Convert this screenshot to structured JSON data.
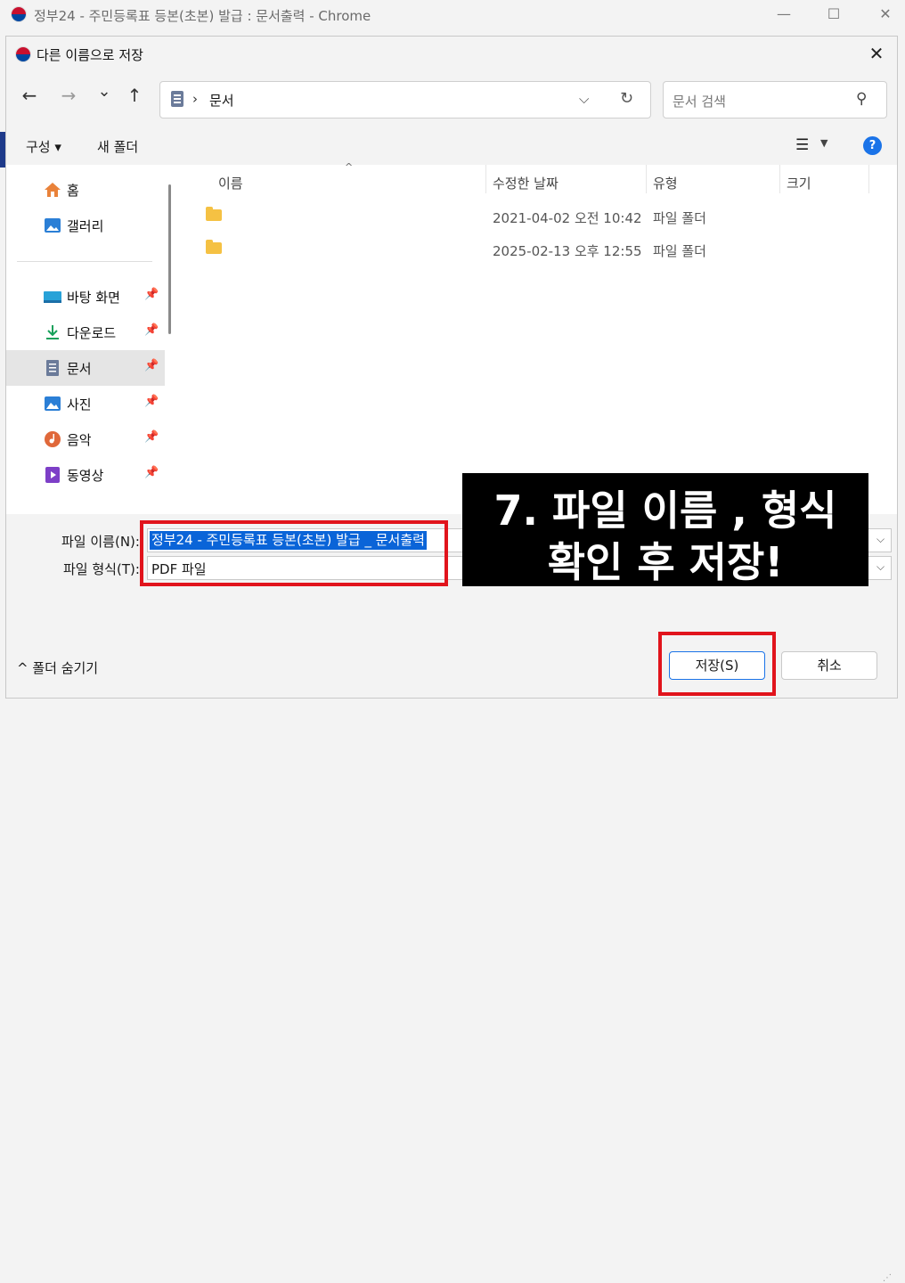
{
  "chrome": {
    "title": "정부24 - 주민등록표 등본(초본) 발급 : 문서출력 - Chrome",
    "minimize": "—",
    "maximize": "☐",
    "close": "✕"
  },
  "dialog": {
    "title": "다른 이름으로 저장",
    "close": "✕"
  },
  "nav": {
    "back": "←",
    "forward": "→",
    "recent": "⌄",
    "up": "↑",
    "breadcrumb_sep": "›",
    "location": "문서",
    "search_placeholder": "문서 검색"
  },
  "toolbar": {
    "organize": "구성 ▾",
    "new_folder": "새 폴더",
    "help": "?"
  },
  "sidebar": {
    "items": [
      {
        "label": "홈",
        "icon": "home-icon"
      },
      {
        "label": "갤러리",
        "icon": "gallery-icon"
      },
      {
        "label": "바탕 화면",
        "icon": "desktop-icon",
        "pinned": true
      },
      {
        "label": "다운로드",
        "icon": "download-icon",
        "pinned": true
      },
      {
        "label": "문서",
        "icon": "documents-icon",
        "pinned": true,
        "selected": true
      },
      {
        "label": "사진",
        "icon": "pictures-icon",
        "pinned": true
      },
      {
        "label": "음악",
        "icon": "music-icon",
        "pinned": true
      },
      {
        "label": "동영상",
        "icon": "videos-icon",
        "pinned": true
      }
    ]
  },
  "filelist": {
    "columns": [
      "이름",
      "수정한 날짜",
      "유형",
      "크기"
    ],
    "rows": [
      {
        "name": "",
        "modified": "2021-04-02 오전 10:42",
        "type": "파일 폴더",
        "size": ""
      },
      {
        "name": "",
        "modified": "2025-02-13 오후 12:55",
        "type": "파일 폴더",
        "size": ""
      }
    ]
  },
  "form": {
    "filename_label": "파일 이름(N):",
    "filename_value": "정부24 - 주민등록표 등본(초본) 발급 _ 문서출력",
    "filetype_label": "파일 형식(T):",
    "filetype_value": "PDF 파일"
  },
  "annotation": {
    "line1": "7. 파일 이름 , 형식",
    "line2": "확인 후 저장!"
  },
  "footer": {
    "hide_folders": "^ 폴더 숨기기",
    "save": "저장(S)",
    "cancel": "취소"
  },
  "colors": {
    "highlight_red": "#e1141c",
    "selection_blue": "#0a64d8",
    "accent_blue": "#1a73e8",
    "folder_yellow": "#f5c143"
  }
}
